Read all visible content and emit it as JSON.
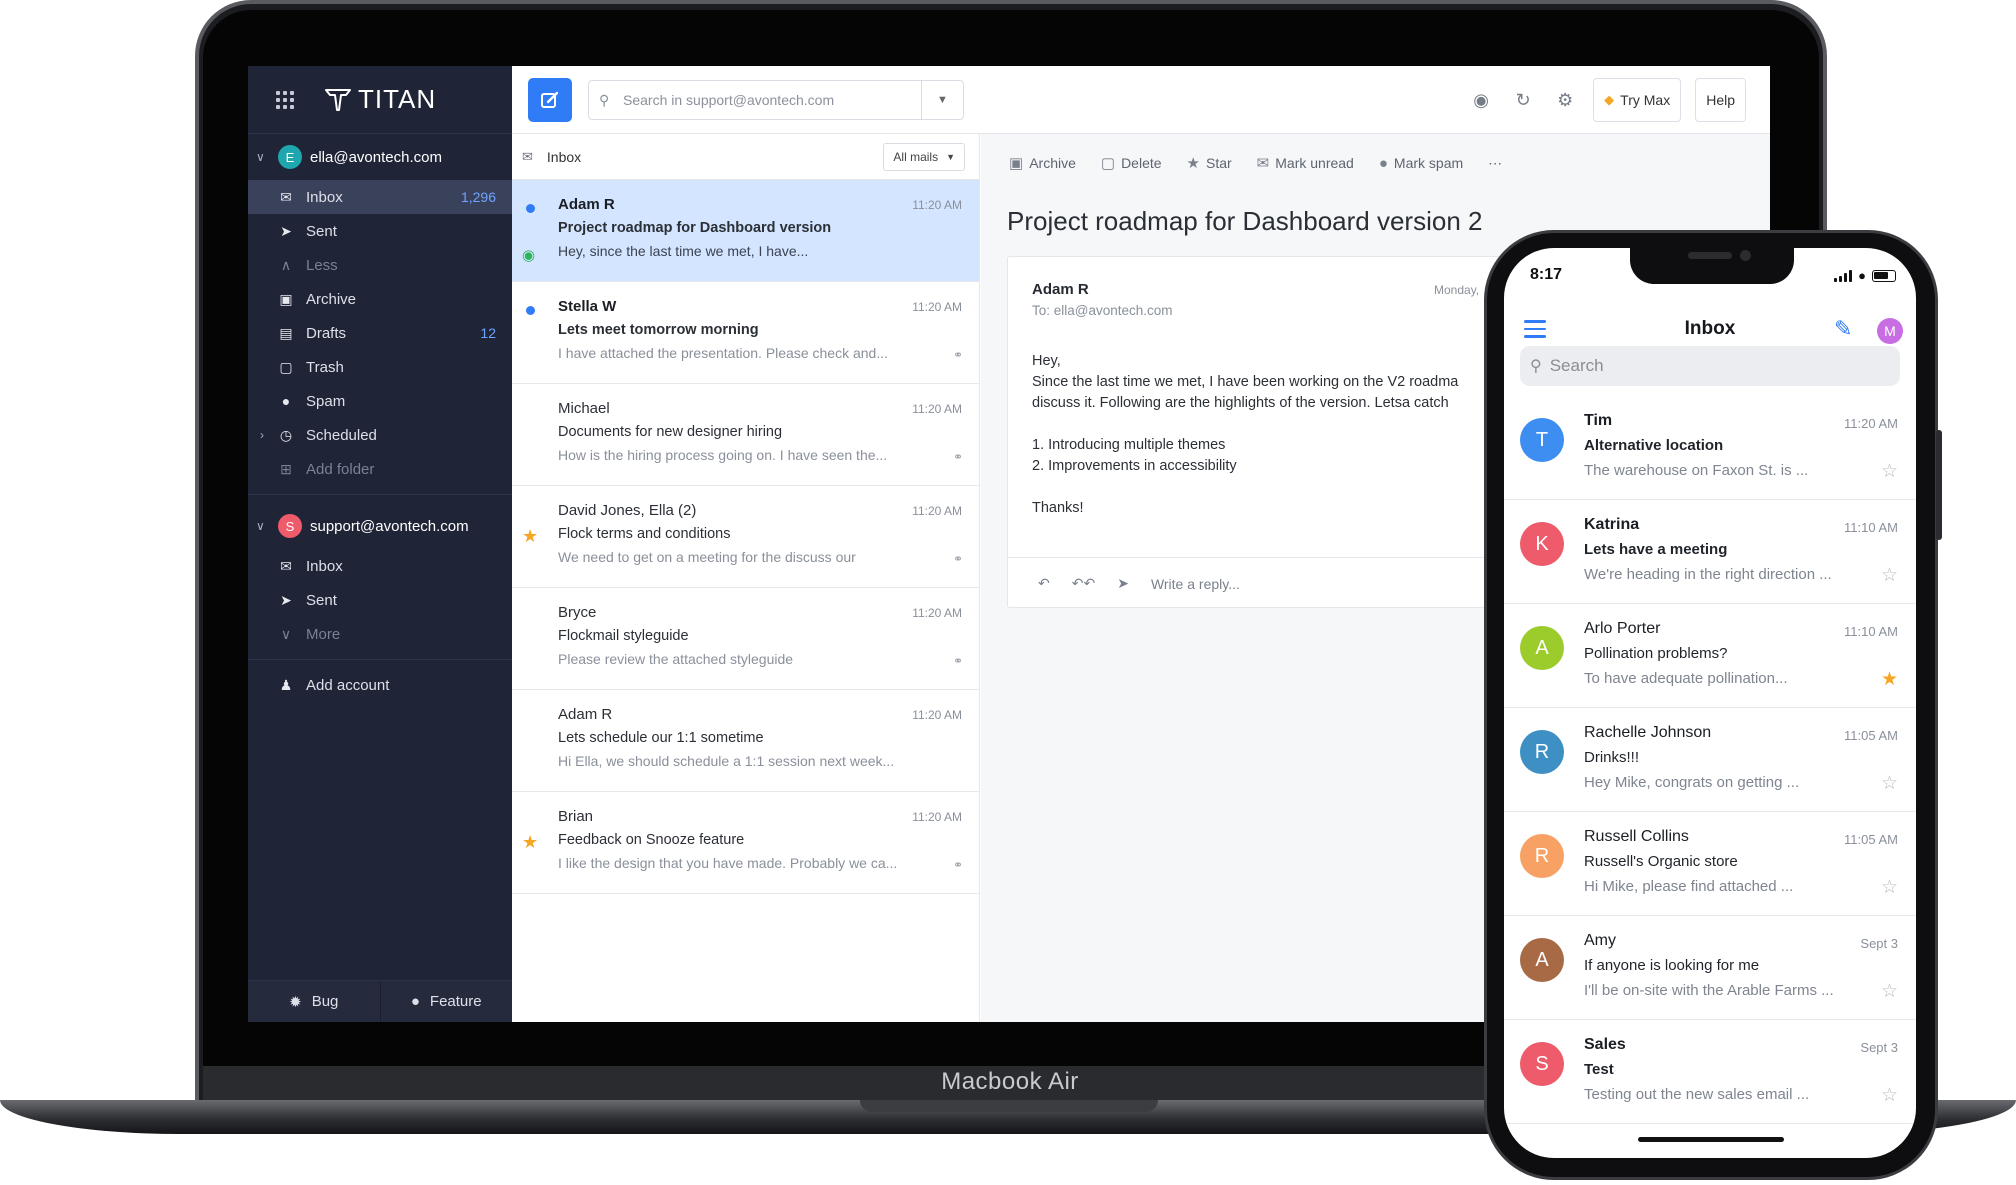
{
  "brand": {
    "app_name": "TITAN",
    "device_label": "Macbook Air"
  },
  "accounts": [
    {
      "email": "ella@avontech.com",
      "initial": "E",
      "color": "#1fa7b0",
      "folders": [
        {
          "label": "Inbox",
          "count": "1,296",
          "icon": "inbox-icon",
          "active": true
        },
        {
          "label": "Sent",
          "count": "",
          "icon": "send-icon"
        },
        {
          "label": "Less",
          "count": "",
          "icon": "chevron-up-icon",
          "muted": true
        },
        {
          "label": "Archive",
          "count": "",
          "icon": "archive-icon"
        },
        {
          "label": "Drafts",
          "count": "12",
          "icon": "drafts-icon"
        },
        {
          "label": "Trash",
          "count": "",
          "icon": "trash-icon"
        },
        {
          "label": "Spam",
          "count": "",
          "icon": "spam-icon"
        },
        {
          "label": "Scheduled",
          "count": "",
          "icon": "scheduled-icon"
        },
        {
          "label": "Add folder",
          "count": "",
          "icon": "add-folder-icon",
          "muted": true
        }
      ]
    },
    {
      "email": "support@avontech.com",
      "initial": "S",
      "color": "#ee5b6b",
      "folders": [
        {
          "label": "Inbox",
          "icon": "inbox-icon"
        },
        {
          "label": "Sent",
          "icon": "send-icon"
        },
        {
          "label": "More",
          "icon": "chevron-down-icon",
          "muted": true
        }
      ]
    }
  ],
  "sidebar": {
    "add_account": "Add account",
    "bug": "Bug",
    "feature": "Feature"
  },
  "topbar": {
    "search_placeholder": "Search in support@avontech.com",
    "try_max": "Try Max",
    "help": "Help"
  },
  "list": {
    "folder": "Inbox",
    "filter": "All mails",
    "messages": [
      {
        "from": "Adam R",
        "time": "11:20 AM",
        "subject": "Project roadmap for Dashboard version",
        "snippet": "Hey, since the last time we met, I have...",
        "unread": true,
        "selected": true,
        "dot": true,
        "eye": true
      },
      {
        "from": "Stella W",
        "time": "11:20 AM",
        "subject": "Lets meet tomorrow morning",
        "snippet": "I have attached the presentation. Please check and...",
        "unread": true,
        "dot": true,
        "clip": true
      },
      {
        "from": "Michael",
        "time": "11:20 AM",
        "subject": "Documents for new designer hiring",
        "snippet": "How is the hiring process going on. I have seen the...",
        "clip": true
      },
      {
        "from": "David Jones, Ella (2)",
        "time": "11:20 AM",
        "subject": "Flock terms and conditions",
        "snippet": "We need to get on a meeting for the discuss our",
        "star": true,
        "clip": true
      },
      {
        "from": "Bryce",
        "time": "11:20 AM",
        "subject": "Flockmail styleguide",
        "snippet": "Please review the attached styleguide",
        "clip": true
      },
      {
        "from": "Adam R",
        "time": "11:20 AM",
        "subject": "Lets schedule our 1:1 sometime",
        "snippet": "Hi Ella, we should schedule a 1:1 session next week..."
      },
      {
        "from": "Brian",
        "time": "11:20 AM",
        "subject": "Feedback on Snooze feature",
        "snippet": "I like the design that you have made. Probably we ca...",
        "star": true,
        "clip": true
      }
    ]
  },
  "reader": {
    "tools": [
      {
        "label": "Archive",
        "icon": "archive-icon"
      },
      {
        "label": "Delete",
        "icon": "trash-icon"
      },
      {
        "label": "Star",
        "icon": "star-icon"
      },
      {
        "label": "Mark unread",
        "icon": "envelope-icon"
      },
      {
        "label": "Mark spam",
        "icon": "spam-icon"
      }
    ],
    "title": "Project roadmap for Dashboard version 2",
    "sender": "Adam R",
    "to": "To: ella@avontech.com",
    "date": "Monday,",
    "body": "Hey,\nSince the last time we met, I have been working on the V2 roadma\ndiscuss it. Following are the highlights of the version. Letsa catch\n\n1. Introducing multiple themes\n2. Improvements in accessibility\n\nThanks!",
    "reply_placeholder": "Write a reply..."
  },
  "phone": {
    "clock": "8:17",
    "title": "Inbox",
    "user_initial": "M",
    "search_placeholder": "Search",
    "messages": [
      {
        "initial": "T",
        "color": "#3d8ef0",
        "from": "Tim",
        "time": "11:20 AM",
        "subject": "Alternative location",
        "snippet": "The warehouse on Faxon St. is ...",
        "unread": true,
        "starred": false
      },
      {
        "initial": "K",
        "color": "#ee5b6b",
        "from": "Katrina",
        "time": "11:10 AM",
        "subject": "Lets have a meeting",
        "snippet": "We're heading in the right direction ...",
        "unread": true,
        "starred": false
      },
      {
        "initial": "A",
        "color": "#9ccb2c",
        "from": "Arlo Porter",
        "time": "11:10 AM",
        "subject": "Pollination problems?",
        "snippet": "To have adequate pollination...",
        "unread": false,
        "starred": true
      },
      {
        "initial": "R",
        "color": "#3d8fc4",
        "from": "Rachelle Johnson",
        "time": "11:05 AM",
        "subject": "Drinks!!!",
        "snippet": "Hey Mike, congrats on getting ...",
        "unread": false,
        "starred": false
      },
      {
        "initial": "R",
        "color": "#f7a165",
        "from": "Russell Collins",
        "time": "11:05 AM",
        "subject": "Russell's Organic store",
        "snippet": "Hi Mike, please find attached ...",
        "unread": false,
        "starred": false
      },
      {
        "initial": "A",
        "color": "#a86a45",
        "from": "Amy",
        "time": "Sept 3",
        "subject": "If anyone is looking for me",
        "snippet": "I'll be on-site with the Arable Farms ...",
        "unread": false,
        "starred": false
      },
      {
        "initial": "S",
        "color": "#ee5b6b",
        "from": "Sales",
        "time": "Sept 3",
        "subject": "Test",
        "snippet": "Testing out the new sales email ...",
        "unread": true,
        "starred": false
      }
    ]
  }
}
